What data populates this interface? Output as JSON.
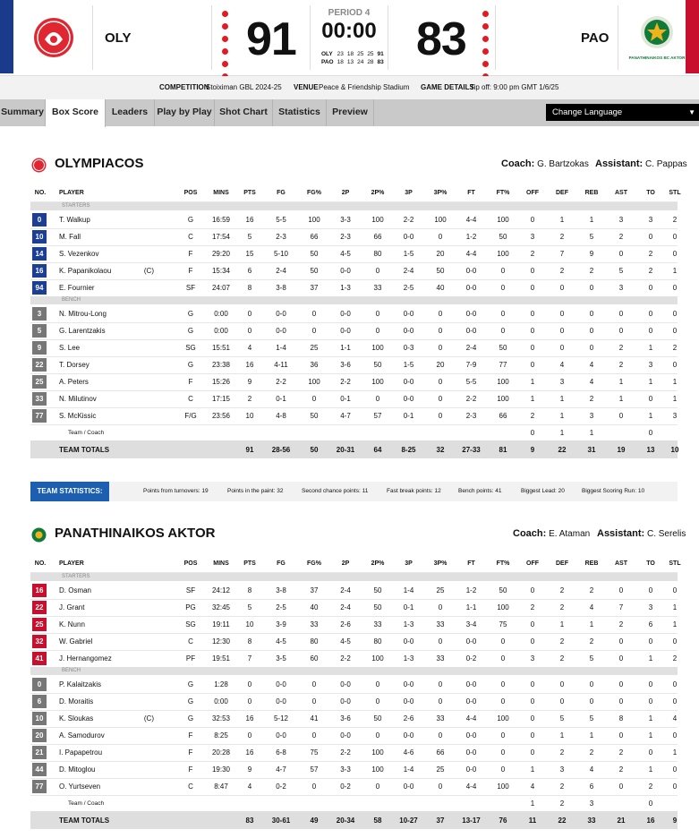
{
  "scoreboard": {
    "home_abbr": "OLY",
    "away_abbr": "PAO",
    "home_score": "91",
    "away_score": "83",
    "period": "PERIOD 4",
    "clock": "00:00",
    "home_logo_text": "OLYMPIACOS BASKETBALL",
    "away_logo_text": "PANATHINAIKOS BC AKTOR",
    "quarters": [
      {
        "team": "OLY",
        "q": [
          "23",
          "18",
          "25",
          "25"
        ],
        "total": "91"
      },
      {
        "team": "PAO",
        "q": [
          "18",
          "13",
          "24",
          "28"
        ],
        "total": "83"
      }
    ],
    "colors": {
      "home": "#1a3b8c",
      "away": "#c8102e",
      "dots": "#e21b23"
    }
  },
  "info": {
    "competition_label": "COMPETITION",
    "competition": "Stoiximan GBL 2024-25",
    "venue_label": "VENUE",
    "venue": "Peace & Friendship Stadium",
    "details_label": "GAME DETAILS",
    "details": "Tip off: 9:00 pm GMT 1/6/25"
  },
  "tabs": [
    "Summary",
    "Box Score",
    "Leaders",
    "Play by Play",
    "Shot Chart",
    "Statistics",
    "Preview"
  ],
  "active_tab": "Box Score",
  "language": "Change Language",
  "columns": [
    "NO.",
    "PLAYER",
    "POS",
    "MINS",
    "PTS",
    "FG",
    "FG%",
    "2P",
    "2P%",
    "3P",
    "3P%",
    "FT",
    "FT%",
    "OFF",
    "DEF",
    "REB",
    "AST",
    "TO",
    "STL"
  ],
  "starters_label": "STARTERS",
  "bench_label": "BENCH",
  "team_coach_label": "Team / Coach",
  "totals_label": "TEAM TOTALS",
  "coach_label": "Coach:",
  "assistant_label": "Assistant:",
  "home": {
    "name": "OLYMPIACOS",
    "coach": "G. Bartzokas",
    "assistant": "C. Pappas",
    "starters": [
      [
        "0",
        "T. Walkup",
        "",
        "G",
        "16:59",
        "16",
        "5-5",
        "100",
        "3-3",
        "100",
        "2-2",
        "100",
        "4-4",
        "100",
        "0",
        "1",
        "1",
        "3",
        "3",
        "2"
      ],
      [
        "10",
        "M. Fall",
        "",
        "C",
        "17:54",
        "5",
        "2-3",
        "66",
        "2-3",
        "66",
        "0-0",
        "0",
        "1-2",
        "50",
        "3",
        "2",
        "5",
        "2",
        "0",
        "0"
      ],
      [
        "14",
        "S. Vezenkov",
        "",
        "F",
        "29:20",
        "15",
        "5-10",
        "50",
        "4-5",
        "80",
        "1-5",
        "20",
        "4-4",
        "100",
        "2",
        "7",
        "9",
        "0",
        "2",
        "0"
      ],
      [
        "16",
        "K. Papanikolaou",
        "(C)",
        "F",
        "15:34",
        "6",
        "2-4",
        "50",
        "0-0",
        "0",
        "2-4",
        "50",
        "0-0",
        "0",
        "0",
        "2",
        "2",
        "5",
        "2",
        "1"
      ],
      [
        "94",
        "E. Fournier",
        "",
        "SF",
        "24:07",
        "8",
        "3-8",
        "37",
        "1-3",
        "33",
        "2-5",
        "40",
        "0-0",
        "0",
        "0",
        "0",
        "0",
        "3",
        "0",
        "0"
      ]
    ],
    "bench": [
      [
        "3",
        "N. Mitrou-Long",
        "",
        "G",
        "0:00",
        "0",
        "0-0",
        "0",
        "0-0",
        "0",
        "0-0",
        "0",
        "0-0",
        "0",
        "0",
        "0",
        "0",
        "0",
        "0",
        "0"
      ],
      [
        "5",
        "G. Larentzakis",
        "",
        "G",
        "0:00",
        "0",
        "0-0",
        "0",
        "0-0",
        "0",
        "0-0",
        "0",
        "0-0",
        "0",
        "0",
        "0",
        "0",
        "0",
        "0",
        "0"
      ],
      [
        "9",
        "S. Lee",
        "",
        "SG",
        "15:51",
        "4",
        "1-4",
        "25",
        "1-1",
        "100",
        "0-3",
        "0",
        "2-4",
        "50",
        "0",
        "0",
        "0",
        "2",
        "1",
        "2"
      ],
      [
        "22",
        "T. Dorsey",
        "",
        "G",
        "23:38",
        "16",
        "4-11",
        "36",
        "3-6",
        "50",
        "1-5",
        "20",
        "7-9",
        "77",
        "0",
        "4",
        "4",
        "2",
        "3",
        "0"
      ],
      [
        "25",
        "A. Peters",
        "",
        "F",
        "15:26",
        "9",
        "2-2",
        "100",
        "2-2",
        "100",
        "0-0",
        "0",
        "5-5",
        "100",
        "1",
        "3",
        "4",
        "1",
        "1",
        "1"
      ],
      [
        "33",
        "N. Milutinov",
        "",
        "C",
        "17:15",
        "2",
        "0-1",
        "0",
        "0-1",
        "0",
        "0-0",
        "0",
        "2-2",
        "100",
        "1",
        "1",
        "2",
        "1",
        "0",
        "1"
      ],
      [
        "77",
        "S. McKissic",
        "",
        "F/G",
        "23:56",
        "10",
        "4-8",
        "50",
        "4-7",
        "57",
        "0-1",
        "0",
        "2-3",
        "66",
        "2",
        "1",
        "3",
        "0",
        "1",
        "3"
      ]
    ],
    "team_coach": [
      "",
      "",
      "",
      "",
      "",
      "",
      "",
      "",
      "",
      "",
      "",
      "0",
      "1",
      "1",
      "",
      "0",
      ""
    ],
    "totals": [
      "",
      "",
      "91",
      "28-56",
      "50",
      "20-31",
      "64",
      "8-25",
      "32",
      "27-33",
      "81",
      "9",
      "22",
      "31",
      "19",
      "13",
      "10"
    ]
  },
  "team_stats": {
    "label": "TEAM STATISTICS:",
    "items": [
      {
        "label": "Points from turnovers:",
        "value": "19"
      },
      {
        "label": "Points in the paint:",
        "value": "32"
      },
      {
        "label": "Second chance points:",
        "value": "11"
      },
      {
        "label": "Fast break points:",
        "value": "12"
      },
      {
        "label": "Bench points:",
        "value": "41"
      },
      {
        "label": "Biggest Lead:",
        "value": "20"
      },
      {
        "label": "Biggest Scoring Run:",
        "value": "10"
      }
    ]
  },
  "away": {
    "name": "PANATHINAIKOS AKTOR",
    "coach": "E. Ataman",
    "assistant": "C. Serelis",
    "starters": [
      [
        "16",
        "D. Osman",
        "",
        "SF",
        "24:12",
        "8",
        "3-8",
        "37",
        "2-4",
        "50",
        "1-4",
        "25",
        "1-2",
        "50",
        "0",
        "2",
        "2",
        "0",
        "0",
        "0"
      ],
      [
        "22",
        "J. Grant",
        "",
        "PG",
        "32:45",
        "5",
        "2-5",
        "40",
        "2-4",
        "50",
        "0-1",
        "0",
        "1-1",
        "100",
        "2",
        "2",
        "4",
        "7",
        "3",
        "1"
      ],
      [
        "25",
        "K. Nunn",
        "",
        "SG",
        "19:11",
        "10",
        "3-9",
        "33",
        "2-6",
        "33",
        "1-3",
        "33",
        "3-4",
        "75",
        "0",
        "1",
        "1",
        "2",
        "6",
        "1"
      ],
      [
        "32",
        "W. Gabriel",
        "",
        "C",
        "12:30",
        "8",
        "4-5",
        "80",
        "4-5",
        "80",
        "0-0",
        "0",
        "0-0",
        "0",
        "0",
        "2",
        "2",
        "0",
        "0",
        "0"
      ],
      [
        "41",
        "J. Hernangomez",
        "",
        "PF",
        "19:51",
        "7",
        "3-5",
        "60",
        "2-2",
        "100",
        "1-3",
        "33",
        "0-2",
        "0",
        "3",
        "2",
        "5",
        "0",
        "1",
        "2"
      ]
    ],
    "bench": [
      [
        "0",
        "P. Kalaitzakis",
        "",
        "G",
        "1:28",
        "0",
        "0-0",
        "0",
        "0-0",
        "0",
        "0-0",
        "0",
        "0-0",
        "0",
        "0",
        "0",
        "0",
        "0",
        "0",
        "0"
      ],
      [
        "6",
        "D. Moraitis",
        "",
        "G",
        "0:00",
        "0",
        "0-0",
        "0",
        "0-0",
        "0",
        "0-0",
        "0",
        "0-0",
        "0",
        "0",
        "0",
        "0",
        "0",
        "0",
        "0"
      ],
      [
        "10",
        "K. Sloukas",
        "(C)",
        "G",
        "32:53",
        "16",
        "5-12",
        "41",
        "3-6",
        "50",
        "2-6",
        "33",
        "4-4",
        "100",
        "0",
        "5",
        "5",
        "8",
        "1",
        "4"
      ],
      [
        "20",
        "A. Samodurov",
        "",
        "F",
        "8:25",
        "0",
        "0-0",
        "0",
        "0-0",
        "0",
        "0-0",
        "0",
        "0-0",
        "0",
        "0",
        "1",
        "1",
        "0",
        "1",
        "0"
      ],
      [
        "21",
        "I. Papapetrou",
        "",
        "F",
        "20:28",
        "16",
        "6-8",
        "75",
        "2-2",
        "100",
        "4-6",
        "66",
        "0-0",
        "0",
        "0",
        "2",
        "2",
        "2",
        "0",
        "1"
      ],
      [
        "44",
        "D. Mitoglou",
        "",
        "F",
        "19:30",
        "9",
        "4-7",
        "57",
        "3-3",
        "100",
        "1-4",
        "25",
        "0-0",
        "0",
        "1",
        "3",
        "4",
        "2",
        "1",
        "0"
      ],
      [
        "77",
        "O. Yurtseven",
        "",
        "C",
        "8:47",
        "4",
        "0-2",
        "0",
        "0-2",
        "0",
        "0-0",
        "0",
        "4-4",
        "100",
        "4",
        "2",
        "6",
        "0",
        "2",
        "0"
      ]
    ],
    "team_coach": [
      "",
      "",
      "",
      "",
      "",
      "",
      "",
      "",
      "",
      "",
      "",
      "1",
      "2",
      "3",
      "",
      "0",
      ""
    ],
    "totals": [
      "",
      "",
      "83",
      "30-61",
      "49",
      "20-34",
      "58",
      "10-27",
      "37",
      "13-17",
      "76",
      "11",
      "22",
      "33",
      "21",
      "16",
      "9"
    ]
  }
}
